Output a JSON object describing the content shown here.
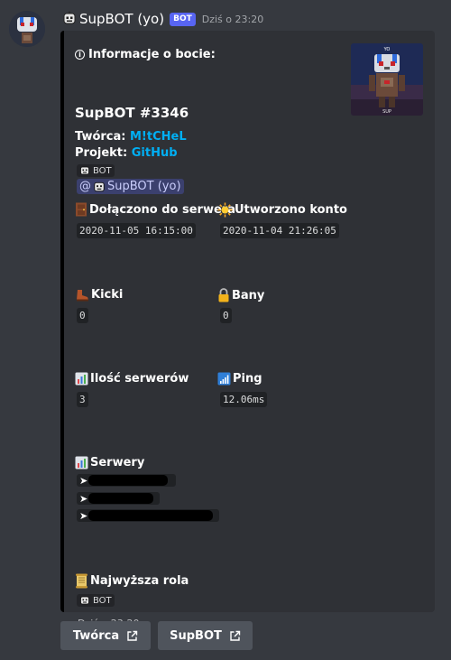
{
  "message": {
    "author": "SupBOT (yo)",
    "bot_tag": "BOT",
    "timestamp": "Dziś o 23:20"
  },
  "embed": {
    "accent_color": "#000000",
    "description_title": "Informacje o bocie:",
    "bot_name": "SupBOT #3346",
    "creator_label": "Twórca:",
    "creator_value": "M!tCHeL",
    "project_label": "Projekt:",
    "project_value": "GitHub",
    "role_chip": "BOT",
    "mention_prefix": "@",
    "mention_name": "SupBOT (yo)",
    "thumbnail_caption": "SUP",
    "fields": {
      "joined": {
        "name": "Dołączono do serwera",
        "value": "2020-11-05 16:15:00",
        "icon": "door-icon"
      },
      "created": {
        "name": "Utworzono konto",
        "value": "2020-11-04 21:26:05",
        "icon": "sun-icon"
      },
      "kicks": {
        "name": "Kicki",
        "value": "0",
        "icon": "boot-icon"
      },
      "bans": {
        "name": "Bany",
        "value": "0",
        "icon": "lock-icon"
      },
      "server_count": {
        "name": "Ilość serwerów",
        "value": "3",
        "icon": "bar-chart-icon"
      },
      "ping": {
        "name": "Ping",
        "value": "12.06ms",
        "icon": "signal-bars-icon"
      },
      "servers": {
        "name": "Serwery",
        "icon": "bar-chart-icon",
        "rows": [
          "➤",
          "➤",
          "➤"
        ]
      },
      "top_role": {
        "name": "Najwyższa rola",
        "value": "BOT",
        "icon": "scroll-icon"
      }
    },
    "footer": "Dziś o 23:20"
  },
  "buttons": {
    "creator": "Twórca",
    "supbot": "SupBOT"
  },
  "colors": {
    "background": "#36393f",
    "embed_bg": "#2f3136",
    "link": "#00aff4",
    "bot_tag": "#5865f2",
    "button": "#4f545c"
  }
}
